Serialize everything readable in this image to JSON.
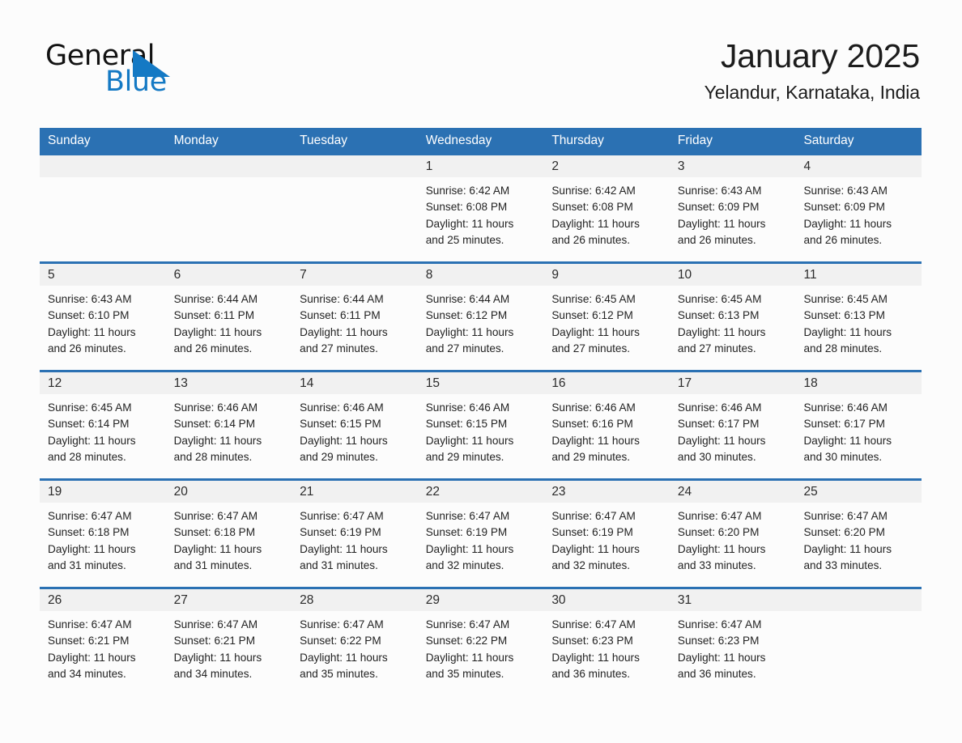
{
  "brand": {
    "name_part1": "General",
    "name_part2": "Blue",
    "triangle_color": "#1479c4"
  },
  "header": {
    "title": "January 2025",
    "subtitle": "Yelandur, Karnataka, India"
  },
  "theme": {
    "header_blue": "#2b71b3",
    "daynum_band": "#f1f1f1",
    "page_background": "#fcfcfc",
    "text": "#232323"
  },
  "weekdays": [
    "Sunday",
    "Monday",
    "Tuesday",
    "Wednesday",
    "Thursday",
    "Friday",
    "Saturday"
  ],
  "labels": {
    "sunrise_prefix": "Sunrise:",
    "sunset_prefix": "Sunset:",
    "daylight_prefix": "Daylight:"
  },
  "weeks": [
    {
      "days": [
        {
          "num": "",
          "sunrise": "",
          "sunset": "",
          "daylight_line1": "",
          "daylight_line2": ""
        },
        {
          "num": "",
          "sunrise": "",
          "sunset": "",
          "daylight_line1": "",
          "daylight_line2": ""
        },
        {
          "num": "",
          "sunrise": "",
          "sunset": "",
          "daylight_line1": "",
          "daylight_line2": ""
        },
        {
          "num": "1",
          "sunrise": "Sunrise: 6:42 AM",
          "sunset": "Sunset: 6:08 PM",
          "daylight_line1": "Daylight: 11 hours",
          "daylight_line2": "and 25 minutes."
        },
        {
          "num": "2",
          "sunrise": "Sunrise: 6:42 AM",
          "sunset": "Sunset: 6:08 PM",
          "daylight_line1": "Daylight: 11 hours",
          "daylight_line2": "and 26 minutes."
        },
        {
          "num": "3",
          "sunrise": "Sunrise: 6:43 AM",
          "sunset": "Sunset: 6:09 PM",
          "daylight_line1": "Daylight: 11 hours",
          "daylight_line2": "and 26 minutes."
        },
        {
          "num": "4",
          "sunrise": "Sunrise: 6:43 AM",
          "sunset": "Sunset: 6:09 PM",
          "daylight_line1": "Daylight: 11 hours",
          "daylight_line2": "and 26 minutes."
        }
      ]
    },
    {
      "days": [
        {
          "num": "5",
          "sunrise": "Sunrise: 6:43 AM",
          "sunset": "Sunset: 6:10 PM",
          "daylight_line1": "Daylight: 11 hours",
          "daylight_line2": "and 26 minutes."
        },
        {
          "num": "6",
          "sunrise": "Sunrise: 6:44 AM",
          "sunset": "Sunset: 6:11 PM",
          "daylight_line1": "Daylight: 11 hours",
          "daylight_line2": "and 26 minutes."
        },
        {
          "num": "7",
          "sunrise": "Sunrise: 6:44 AM",
          "sunset": "Sunset: 6:11 PM",
          "daylight_line1": "Daylight: 11 hours",
          "daylight_line2": "and 27 minutes."
        },
        {
          "num": "8",
          "sunrise": "Sunrise: 6:44 AM",
          "sunset": "Sunset: 6:12 PM",
          "daylight_line1": "Daylight: 11 hours",
          "daylight_line2": "and 27 minutes."
        },
        {
          "num": "9",
          "sunrise": "Sunrise: 6:45 AM",
          "sunset": "Sunset: 6:12 PM",
          "daylight_line1": "Daylight: 11 hours",
          "daylight_line2": "and 27 minutes."
        },
        {
          "num": "10",
          "sunrise": "Sunrise: 6:45 AM",
          "sunset": "Sunset: 6:13 PM",
          "daylight_line1": "Daylight: 11 hours",
          "daylight_line2": "and 27 minutes."
        },
        {
          "num": "11",
          "sunrise": "Sunrise: 6:45 AM",
          "sunset": "Sunset: 6:13 PM",
          "daylight_line1": "Daylight: 11 hours",
          "daylight_line2": "and 28 minutes."
        }
      ]
    },
    {
      "days": [
        {
          "num": "12",
          "sunrise": "Sunrise: 6:45 AM",
          "sunset": "Sunset: 6:14 PM",
          "daylight_line1": "Daylight: 11 hours",
          "daylight_line2": "and 28 minutes."
        },
        {
          "num": "13",
          "sunrise": "Sunrise: 6:46 AM",
          "sunset": "Sunset: 6:14 PM",
          "daylight_line1": "Daylight: 11 hours",
          "daylight_line2": "and 28 minutes."
        },
        {
          "num": "14",
          "sunrise": "Sunrise: 6:46 AM",
          "sunset": "Sunset: 6:15 PM",
          "daylight_line1": "Daylight: 11 hours",
          "daylight_line2": "and 29 minutes."
        },
        {
          "num": "15",
          "sunrise": "Sunrise: 6:46 AM",
          "sunset": "Sunset: 6:15 PM",
          "daylight_line1": "Daylight: 11 hours",
          "daylight_line2": "and 29 minutes."
        },
        {
          "num": "16",
          "sunrise": "Sunrise: 6:46 AM",
          "sunset": "Sunset: 6:16 PM",
          "daylight_line1": "Daylight: 11 hours",
          "daylight_line2": "and 29 minutes."
        },
        {
          "num": "17",
          "sunrise": "Sunrise: 6:46 AM",
          "sunset": "Sunset: 6:17 PM",
          "daylight_line1": "Daylight: 11 hours",
          "daylight_line2": "and 30 minutes."
        },
        {
          "num": "18",
          "sunrise": "Sunrise: 6:46 AM",
          "sunset": "Sunset: 6:17 PM",
          "daylight_line1": "Daylight: 11 hours",
          "daylight_line2": "and 30 minutes."
        }
      ]
    },
    {
      "days": [
        {
          "num": "19",
          "sunrise": "Sunrise: 6:47 AM",
          "sunset": "Sunset: 6:18 PM",
          "daylight_line1": "Daylight: 11 hours",
          "daylight_line2": "and 31 minutes."
        },
        {
          "num": "20",
          "sunrise": "Sunrise: 6:47 AM",
          "sunset": "Sunset: 6:18 PM",
          "daylight_line1": "Daylight: 11 hours",
          "daylight_line2": "and 31 minutes."
        },
        {
          "num": "21",
          "sunrise": "Sunrise: 6:47 AM",
          "sunset": "Sunset: 6:19 PM",
          "daylight_line1": "Daylight: 11 hours",
          "daylight_line2": "and 31 minutes."
        },
        {
          "num": "22",
          "sunrise": "Sunrise: 6:47 AM",
          "sunset": "Sunset: 6:19 PM",
          "daylight_line1": "Daylight: 11 hours",
          "daylight_line2": "and 32 minutes."
        },
        {
          "num": "23",
          "sunrise": "Sunrise: 6:47 AM",
          "sunset": "Sunset: 6:19 PM",
          "daylight_line1": "Daylight: 11 hours",
          "daylight_line2": "and 32 minutes."
        },
        {
          "num": "24",
          "sunrise": "Sunrise: 6:47 AM",
          "sunset": "Sunset: 6:20 PM",
          "daylight_line1": "Daylight: 11 hours",
          "daylight_line2": "and 33 minutes."
        },
        {
          "num": "25",
          "sunrise": "Sunrise: 6:47 AM",
          "sunset": "Sunset: 6:20 PM",
          "daylight_line1": "Daylight: 11 hours",
          "daylight_line2": "and 33 minutes."
        }
      ]
    },
    {
      "days": [
        {
          "num": "26",
          "sunrise": "Sunrise: 6:47 AM",
          "sunset": "Sunset: 6:21 PM",
          "daylight_line1": "Daylight: 11 hours",
          "daylight_line2": "and 34 minutes."
        },
        {
          "num": "27",
          "sunrise": "Sunrise: 6:47 AM",
          "sunset": "Sunset: 6:21 PM",
          "daylight_line1": "Daylight: 11 hours",
          "daylight_line2": "and 34 minutes."
        },
        {
          "num": "28",
          "sunrise": "Sunrise: 6:47 AM",
          "sunset": "Sunset: 6:22 PM",
          "daylight_line1": "Daylight: 11 hours",
          "daylight_line2": "and 35 minutes."
        },
        {
          "num": "29",
          "sunrise": "Sunrise: 6:47 AM",
          "sunset": "Sunset: 6:22 PM",
          "daylight_line1": "Daylight: 11 hours",
          "daylight_line2": "and 35 minutes."
        },
        {
          "num": "30",
          "sunrise": "Sunrise: 6:47 AM",
          "sunset": "Sunset: 6:23 PM",
          "daylight_line1": "Daylight: 11 hours",
          "daylight_line2": "and 36 minutes."
        },
        {
          "num": "31",
          "sunrise": "Sunrise: 6:47 AM",
          "sunset": "Sunset: 6:23 PM",
          "daylight_line1": "Daylight: 11 hours",
          "daylight_line2": "and 36 minutes."
        },
        {
          "num": "",
          "sunrise": "",
          "sunset": "",
          "daylight_line1": "",
          "daylight_line2": ""
        }
      ]
    }
  ]
}
